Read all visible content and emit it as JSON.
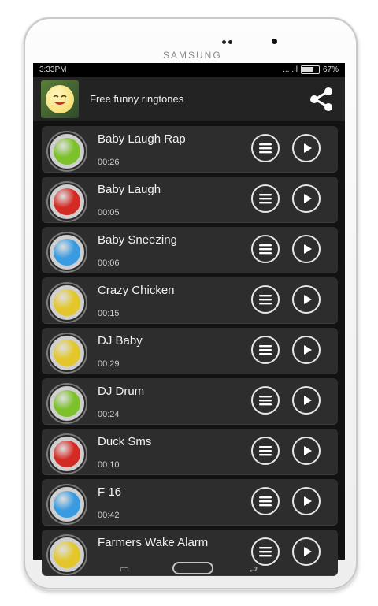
{
  "device": {
    "brand": "SAMSUNG"
  },
  "status_bar": {
    "time": "3:33PM",
    "signal": "... .ıl",
    "battery": "67%"
  },
  "app_bar": {
    "title": "Free funny ringtones",
    "icon": "smiley-app-icon",
    "share_icon": "share-icon"
  },
  "ringtones": [
    {
      "name": "Baby Laugh Rap",
      "duration": "00:26",
      "color": "#7dc12b"
    },
    {
      "name": "Baby Laugh",
      "duration": "00:05",
      "color": "#d42a24"
    },
    {
      "name": "Baby Sneezing",
      "duration": "00:06",
      "color": "#3a9be0"
    },
    {
      "name": "Crazy Chicken",
      "duration": "00:15",
      "color": "#e3c72a"
    },
    {
      "name": "DJ Baby",
      "duration": "00:29",
      "color": "#e3c72a"
    },
    {
      "name": "DJ Drum",
      "duration": "00:24",
      "color": "#7dc12b"
    },
    {
      "name": "Duck Sms",
      "duration": "00:10",
      "color": "#d42a24"
    },
    {
      "name": "F 16",
      "duration": "00:42",
      "color": "#3a9be0"
    },
    {
      "name": "Farmers Wake Alarm",
      "duration": "",
      "color": "#e3c72a"
    }
  ],
  "row_icons": {
    "menu": "menu-icon",
    "play": "play-icon"
  },
  "nav_keys": {
    "back": "⮐",
    "recent": "▭"
  }
}
